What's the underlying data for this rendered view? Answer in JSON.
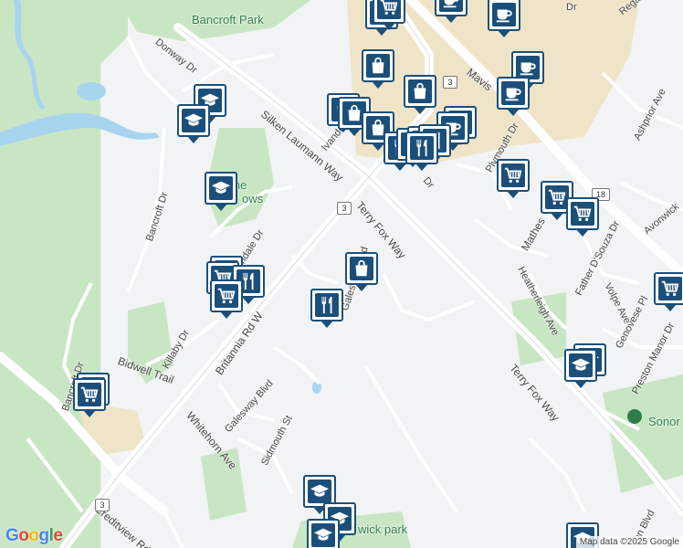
{
  "map": {
    "attribution": "Map data ©2025 Google",
    "logo": "Google",
    "logo_colors": [
      "#4285F4",
      "#EA4335",
      "#FBBC05",
      "#4285F4",
      "#34A853",
      "#EA4335"
    ],
    "colors": {
      "background": "#f1f3f4",
      "park": "#c9e6c4",
      "water": "#a8d4f0",
      "commercial": "#efe4c8",
      "major_road": "#ffffff",
      "pin_fill": "#1b4f7a",
      "park_label": "#2e7d4a"
    }
  },
  "road_labels": {
    "donway": "Donway Dr",
    "silken": "Silken Laumann Way",
    "bancroft_dr": "Bancroft Dr",
    "bancroft_dr_2": "Bancroft Dr",
    "britannia": "Britannia Rd W",
    "bidwell": "Bidwell Trail",
    "killaby": "Killaby Dr",
    "galesway": "Galesway Blvd",
    "galesway_2": "Galesway Blvd",
    "whitehorn": "Whitehorn Ave",
    "sidmouth": "Sidmouth St",
    "terryfox_1": "Terry Fox Way",
    "terryfox_2": "Terry Fox Way",
    "creditview": "Creditview Rd",
    "mavis": "Mavis",
    "plymouth": "Plymouth Dr",
    "mathes": "Mathes",
    "heatherleigh": "Heatherleigh Ave",
    "father": "Father D'Souza Dr",
    "volpe": "Volpe Ave",
    "genovese": "Genovese Pl",
    "preston": "Preston Manor Dr",
    "ashprior": "Ashprior Ave",
    "avonwick": "Avonwick",
    "regal": "Regal",
    "ivanhoe": "Ivande",
    "rosedale": "ondale Dr",
    "ron": "ron Blvd",
    "dr_top": "Dr",
    "dr_mid": "Dr"
  },
  "park_labels": {
    "bancroft_park": "Bancroft Park",
    "sherburne_1": "S      urne",
    "sherburne_2": "ows",
    "wick_park": "wick park",
    "sonor": "Sonor"
  },
  "route_shields": {
    "r3_top": "3",
    "r3_mid": "3",
    "r3_bot": "3",
    "r18": "18"
  },
  "pins": [
    {
      "name": "shopping-cart-pin",
      "icon": "shopping-cart-icon"
    },
    {
      "name": "cafe-pin",
      "icon": "coffee-cup-icon"
    },
    {
      "name": "shopping-bag-pin",
      "icon": "shopping-bag-icon"
    },
    {
      "name": "school-pin",
      "icon": "graduation-cap-icon"
    },
    {
      "name": "restaurant-pin",
      "icon": "fork-knife-icon"
    }
  ]
}
